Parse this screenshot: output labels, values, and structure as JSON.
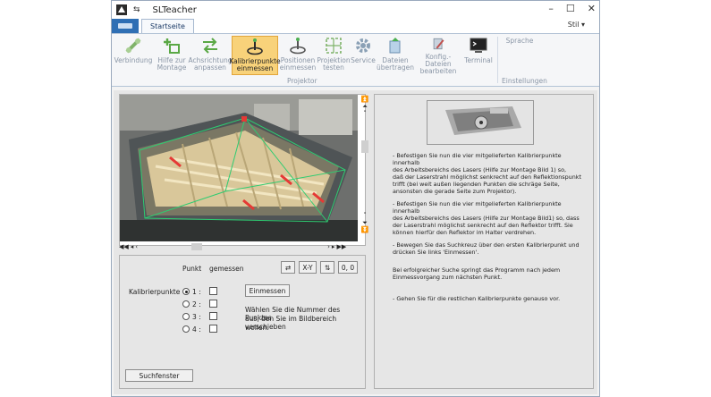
{
  "window": {
    "title": "SLTeacher",
    "qat_symbol": "⇆",
    "min": "–",
    "max": "☐",
    "close": "✕"
  },
  "tabs": {
    "start": "Startseite",
    "style_menu": "Stil ▾"
  },
  "ribbon": {
    "projektor_label": "Projektor",
    "sprache_label": "Sprache",
    "einstellungen_label": "Einstellungen",
    "buttons": [
      {
        "l1": "Verbindung",
        "l2": ""
      },
      {
        "l1": "Hilfe zur",
        "l2": "Montage"
      },
      {
        "l1": "Achsrichtung",
        "l2": "anpassen"
      },
      {
        "l1": "Kalibrierpunkte",
        "l2": "einmessen"
      },
      {
        "l1": "Positionen",
        "l2": "einmessen"
      },
      {
        "l1": "Projektion",
        "l2": "testen"
      },
      {
        "l1": "Service",
        "l2": ""
      },
      {
        "l1": "Dateien",
        "l2": "übertragen"
      },
      {
        "l1": "Konfig.-Dateien",
        "l2": "bearbeiten"
      },
      {
        "l1": "Terminal",
        "l2": ""
      }
    ]
  },
  "controls": {
    "punkt": "Punkt",
    "gemessen": "gemessen",
    "coord": "0, 0",
    "xy": "X-Y",
    "kalibrierpunkte": "Kalibrierpunkte",
    "p1": "1 :",
    "p2": "2 :",
    "p3": "3 :",
    "p4": "4 :",
    "einmessen": "Einmessen",
    "hint1": "Wählen Sie die Nummer des Punktes",
    "hint2": "aus, den Sie im Bildbereich verschieben",
    "hint3": "wollen.",
    "suchfenster": "Suchfenster"
  },
  "instructions": {
    "b1": [
      "- Befestigen Sie nun die vier mitgelieferten Kalibrierpunkte innerhalb",
      "des Arbeitsbereichs des Lasers (Hilfe zur Montage Bild 1) so,",
      "daß der Laserstrahl möglichst senkrecht auf den Reflektionspunkt",
      "trifft (bei weit außen liegenden Punkten die schräge Seite,",
      "ansonsten die gerade Seite zum Projektor)."
    ],
    "b2": [
      "- Befestigen Sie nun die vier mitgelieferten Kalibrierpunkte innerhalb",
      "des Arbeitsbereichs des Lasers (Hilfe zur Montage Bild1) so, dass",
      "der Laserstrahl möglichst senkrecht auf den Reflektor trifft. Sie",
      "können hierfür den Reflektor im Halter verdrehen."
    ],
    "b3": [
      "- Bewegen Sie das Suchkreuz über den ersten Kalibrierpunkt und",
      "drücken Sie links 'Einmessen'."
    ],
    "b4": [
      "Bei erfolgreicher Suche springt das Programm nach jedem",
      "Einmessvorgang zum nächsten Punkt."
    ],
    "b5": [
      "- Gehen Sie für die restlichen Kalibrierpunkte genauso vor."
    ]
  },
  "colors": {
    "accent": "#2f6fb4",
    "active_button": "#f8d27a",
    "laser_line": "#2ecc71",
    "marker": "#e53935"
  }
}
